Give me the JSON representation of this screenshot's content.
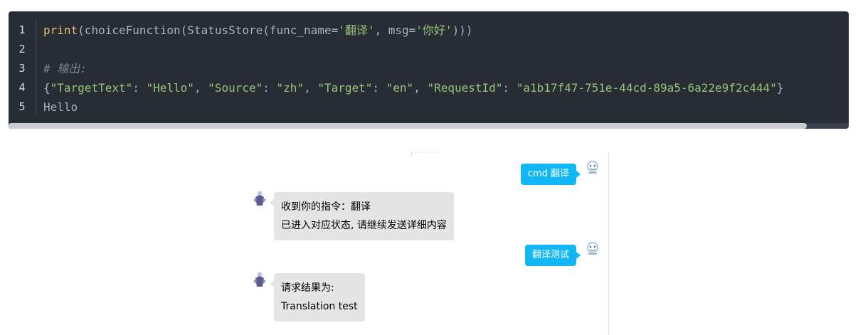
{
  "code": {
    "lines": [
      {
        "num": "1",
        "tokens": [
          {
            "text": "print",
            "cls": "tok-func"
          },
          {
            "text": "(choiceFunction(StatusStore(func_name=",
            "cls": "tok-plain"
          },
          {
            "text": "'翻译'",
            "cls": "tok-str"
          },
          {
            "text": ", msg=",
            "cls": "tok-plain"
          },
          {
            "text": "'你好'",
            "cls": "tok-str"
          },
          {
            "text": ")))",
            "cls": "tok-plain"
          }
        ]
      },
      {
        "num": "2",
        "tokens": []
      },
      {
        "num": "3",
        "tokens": [
          {
            "text": "# 输出:",
            "cls": "tok-comment"
          }
        ]
      },
      {
        "num": "4",
        "tokens": [
          {
            "text": "{",
            "cls": "tok-plain"
          },
          {
            "text": "\"TargetText\"",
            "cls": "tok-str"
          },
          {
            "text": ": ",
            "cls": "tok-plain"
          },
          {
            "text": "\"Hello\"",
            "cls": "tok-str"
          },
          {
            "text": ", ",
            "cls": "tok-plain"
          },
          {
            "text": "\"Source\"",
            "cls": "tok-str"
          },
          {
            "text": ": ",
            "cls": "tok-plain"
          },
          {
            "text": "\"zh\"",
            "cls": "tok-str"
          },
          {
            "text": ", ",
            "cls": "tok-plain"
          },
          {
            "text": "\"Target\"",
            "cls": "tok-str"
          },
          {
            "text": ": ",
            "cls": "tok-plain"
          },
          {
            "text": "\"en\"",
            "cls": "tok-str"
          },
          {
            "text": ", ",
            "cls": "tok-plain"
          },
          {
            "text": "\"RequestId\"",
            "cls": "tok-str"
          },
          {
            "text": ": ",
            "cls": "tok-plain"
          },
          {
            "text": "\"a1b17f47-751e-44cd-89a5-6a22e9f2c444\"",
            "cls": "tok-str"
          },
          {
            "text": "}",
            "cls": "tok-plain"
          }
        ]
      },
      {
        "num": "5",
        "tokens": [
          {
            "text": "Hello",
            "cls": "tok-plain"
          }
        ]
      }
    ]
  },
  "chat": {
    "messages": [
      {
        "side": "right",
        "text": "cmd 翻译"
      },
      {
        "side": "left",
        "lines": [
          "收到你的指令：翻译",
          "已进入对应状态, 请继续发送详细内容"
        ]
      },
      {
        "side": "right",
        "text": "翻译测试"
      },
      {
        "side": "left",
        "lines": [
          "请求结果为:",
          "Translation test"
        ]
      }
    ]
  },
  "colors": {
    "code_bg": "#282c34",
    "bubble_blue": "#12b7f5",
    "bubble_gray": "#e5e5e5"
  }
}
